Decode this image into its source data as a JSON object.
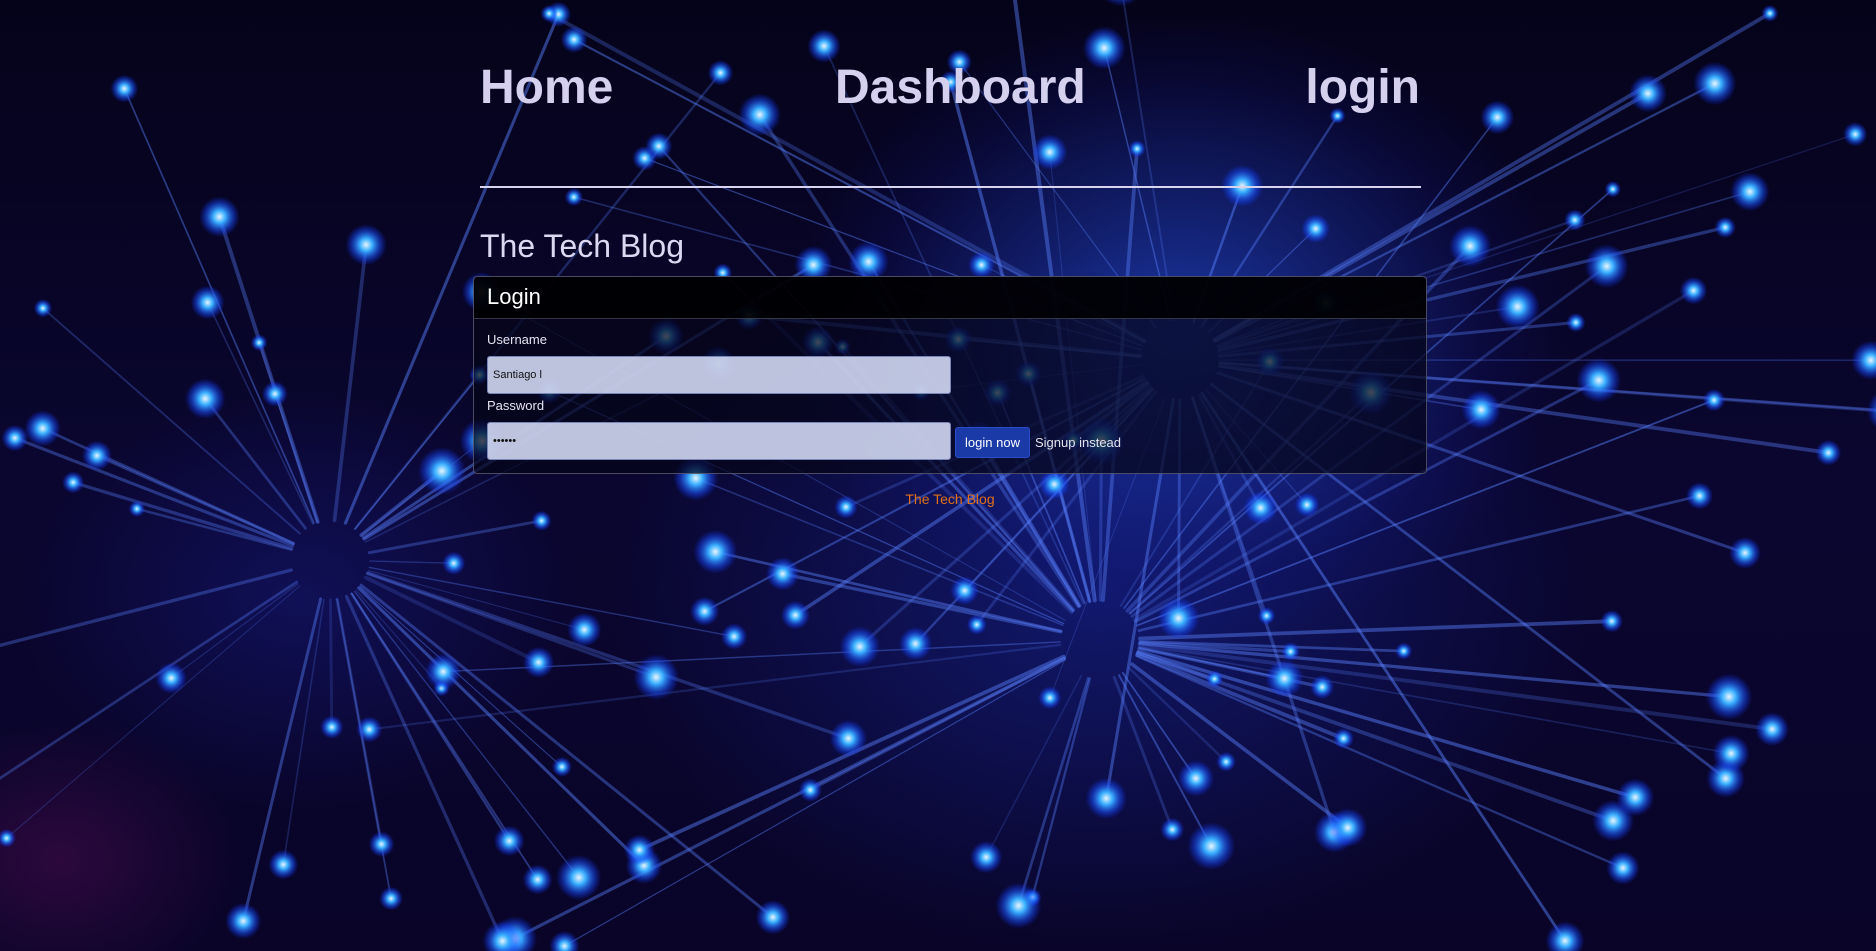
{
  "nav": {
    "home": "Home",
    "dashboard": "Dashboard",
    "login": "login"
  },
  "site_title": "The Tech Blog",
  "login_card": {
    "title": "Login",
    "username_label": "Username",
    "username_value": "Santiago l",
    "password_label": "Password",
    "password_value": "••••••",
    "submit_label": "login now",
    "signup_label": "Signup instead"
  },
  "footer": {
    "text": "The Tech Blog"
  },
  "colors": {
    "background": "#06031f",
    "accent_blue": "#1a3aa8",
    "footer_text": "#e0701a",
    "nav_text": "#d4d0ee"
  }
}
